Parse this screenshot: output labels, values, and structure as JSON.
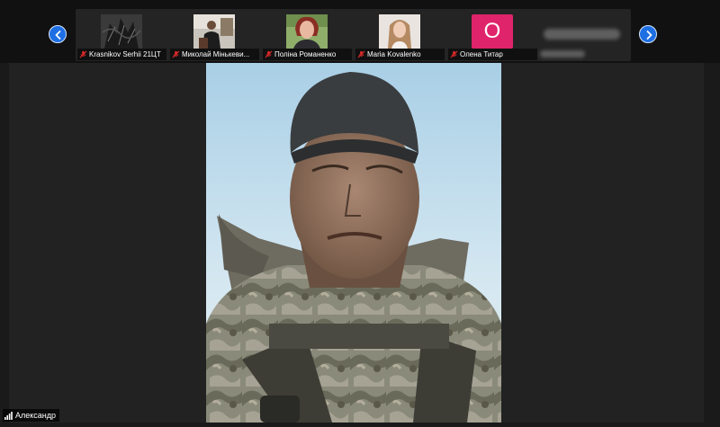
{
  "participants": [
    {
      "name": "Krasnikov Serhii 21ЦТ",
      "muted": true
    },
    {
      "name": "Миколай Мінькеви...",
      "muted": true
    },
    {
      "name": "Поліна Романенко",
      "muted": true
    },
    {
      "name": "Maria Kovalenko",
      "muted": true
    },
    {
      "name": "Олена Титар",
      "muted": true,
      "avatar_initial": "О"
    }
  ],
  "active_speaker": {
    "name": "Александр"
  },
  "colors": {
    "nav_button": "#1e6fe3",
    "avatar_pink": "#e0246b",
    "mic_muted_red": "#e02a2a"
  }
}
